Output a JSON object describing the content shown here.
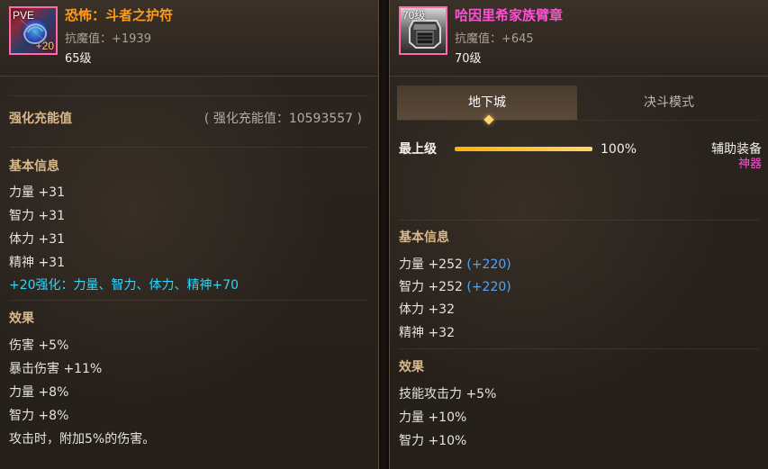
{
  "left_item": {
    "badge": "PVE",
    "plus": "+20",
    "title": "恐怖：斗者之护符",
    "resist": "抗魔值：+1939",
    "level": "65级",
    "charge_label": "强化充能值",
    "charge_value": "( 强化充能值：10593557 )",
    "basic_title": "基本信息",
    "basic_lines": [
      "力量 +31",
      "智力 +31",
      "体力 +31",
      "精神 +31"
    ],
    "reinforce_line": "+20强化：力量、智力、体力、精神+70",
    "effect_title": "效果",
    "effect_lines": [
      "伤害 +5%",
      "暴击伤害 +11%",
      "力量 +8%",
      "智力 +8%",
      "攻击时，附加5%的伤害。"
    ],
    "icon_names": [
      "amulet-icon"
    ]
  },
  "right_item": {
    "badge": "70级",
    "title": "哈因里希家族臂章",
    "resist": "抗魔值：+645",
    "level": "70级",
    "tabs": [
      {
        "label": "地下城",
        "active": true
      },
      {
        "label": "决斗模式",
        "active": false
      }
    ],
    "progress": {
      "label": "最上级",
      "percent_text": "100%",
      "fraction": 1.0
    },
    "aux": {
      "title": "辅助装备",
      "subtitle": "神器"
    },
    "basic_title": "基本信息",
    "basic_lines": [
      {
        "text": "力量 +252",
        "extra": "(+220)"
      },
      {
        "text": "智力 +252",
        "extra": "(+220)"
      },
      {
        "text": "体力 +32",
        "extra": ""
      },
      {
        "text": "精神 +32",
        "extra": ""
      }
    ],
    "effect_title": "效果",
    "effect_lines": [
      "技能攻击力 +5%",
      "力量 +10%",
      "智力 +10%"
    ],
    "icon_names": [
      "bracer-icon"
    ]
  },
  "colors": {
    "accent_orange": "#ff9b1a",
    "accent_pink": "#ff4fd4",
    "cyan": "#27d8ff",
    "blue": "#4da6ff",
    "bar_gold": "#ffd56a"
  }
}
